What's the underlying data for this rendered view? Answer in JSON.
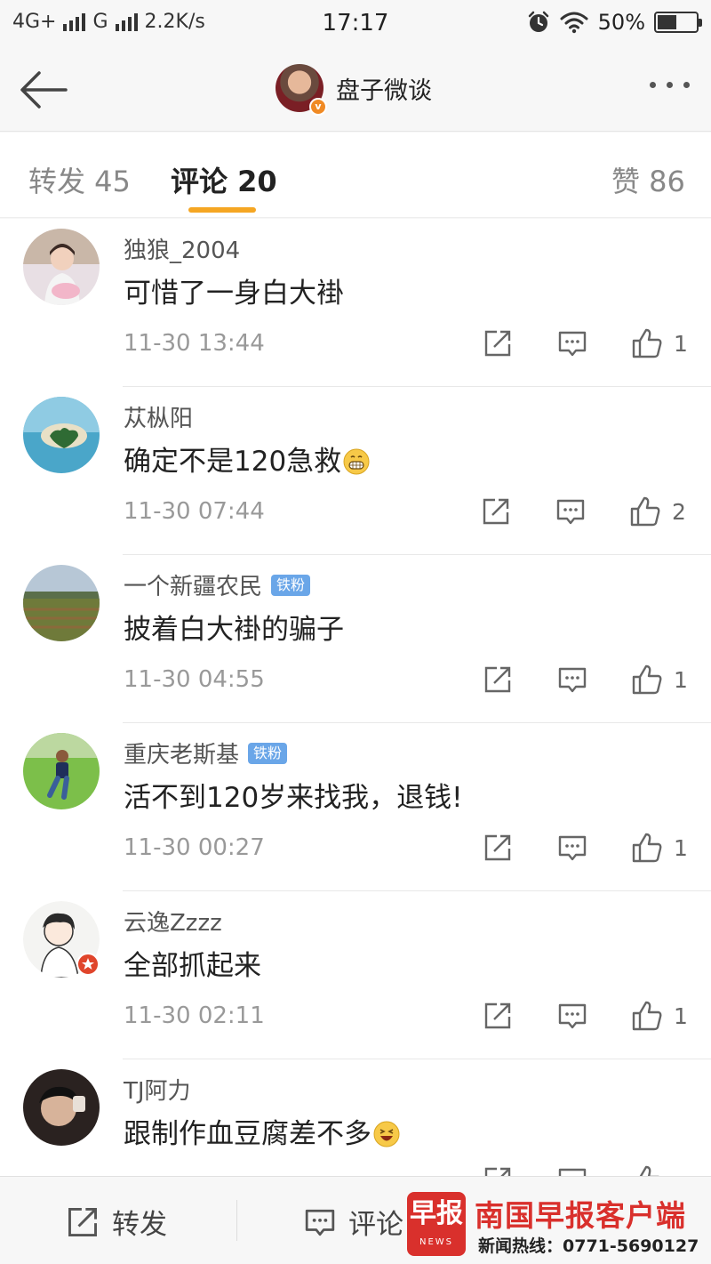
{
  "status_bar": {
    "network_left": "4G+",
    "network_right": "G",
    "speed": "2.2K/s",
    "time": "17:17",
    "battery": "50%",
    "battery_level": 0.5
  },
  "header": {
    "title": "盘子微谈",
    "verified_badge": "v",
    "icons": [
      "back-arrow-icon",
      "more-icon"
    ]
  },
  "tabs": [
    {
      "label": "转发 45"
    },
    {
      "label": "评论 20",
      "active": true
    },
    {
      "label": "赞 86"
    }
  ],
  "comments": [
    {
      "user": "独狼_2004",
      "badge": "",
      "text": "可惜了一身白大褂",
      "emoji": "",
      "time": "11-30 13:44",
      "likes": "1"
    },
    {
      "user": "苁枞阳",
      "badge": "",
      "text": "确定不是120急救",
      "emoji": "grin",
      "time": "11-30 07:44",
      "likes": "2"
    },
    {
      "user": "一个新疆农民",
      "badge": "铁粉",
      "text": "披着白大褂的骗子",
      "emoji": "",
      "time": "11-30 04:55",
      "likes": "1"
    },
    {
      "user": "重庆老斯基",
      "badge": "铁粉",
      "text": "活不到120岁来找我，退钱!",
      "emoji": "",
      "time": "11-30 00:27",
      "likes": "1"
    },
    {
      "user": "云逸Zzzz",
      "badge": "",
      "text": "全部抓起来",
      "emoji": "",
      "time": "11-30 02:11",
      "likes": "1"
    },
    {
      "user": "TJ阿力",
      "badge": "",
      "text": "跟制作血豆腐差不多",
      "emoji": "laugh",
      "time": "",
      "likes": ""
    }
  ],
  "bottom_bar": {
    "repost": "转发",
    "comment": "评论"
  },
  "watermark": {
    "logo": "早报",
    "logo_sub": "NEWS",
    "name": "南国早报客户端",
    "hotline": "新闻热线：0771-5690127"
  },
  "colors": {
    "accent": "#f5a623",
    "fan_badge": "#6aa6e8",
    "watermark_red": "#d9302c"
  }
}
